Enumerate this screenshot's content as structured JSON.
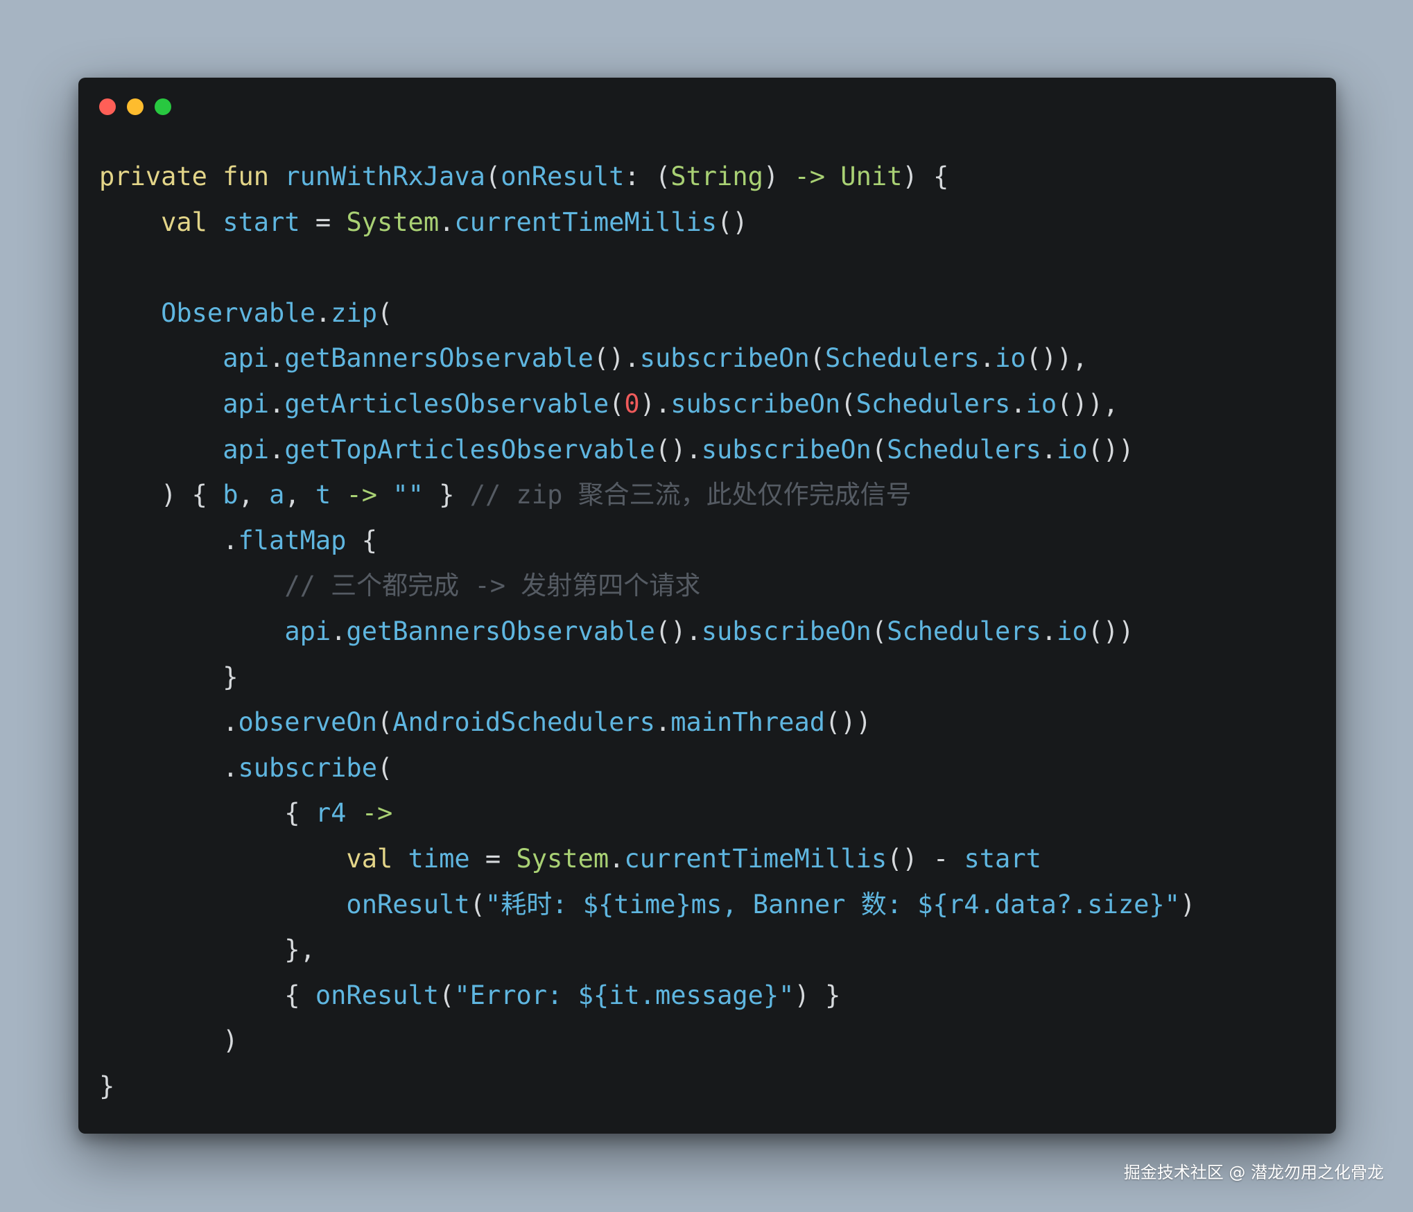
{
  "window": {
    "buttons": [
      {
        "name": "close",
        "color": "#ff5f57"
      },
      {
        "name": "minimize",
        "color": "#febc2e"
      },
      {
        "name": "maximize",
        "color": "#28c840"
      }
    ]
  },
  "code_lines": [
    [
      {
        "t": "private fun ",
        "k": "kw"
      },
      {
        "t": "runWithRxJava",
        "k": "fn"
      },
      {
        "t": "(",
        "k": "plain"
      },
      {
        "t": "onResult",
        "k": "fn"
      },
      {
        "t": ": (",
        "k": "plain"
      },
      {
        "t": "String",
        "k": "ty"
      },
      {
        "t": ") ",
        "k": "plain"
      },
      {
        "t": "->",
        "k": "ty"
      },
      {
        "t": " ",
        "k": "plain"
      },
      {
        "t": "Unit",
        "k": "ty"
      },
      {
        "t": ") {",
        "k": "plain"
      }
    ],
    [
      {
        "t": "    ",
        "k": "plain"
      },
      {
        "t": "val",
        "k": "kw"
      },
      {
        "t": " ",
        "k": "plain"
      },
      {
        "t": "start",
        "k": "fn"
      },
      {
        "t": " = ",
        "k": "plain"
      },
      {
        "t": "System",
        "k": "ty"
      },
      {
        "t": ".",
        "k": "plain"
      },
      {
        "t": "currentTimeMillis",
        "k": "fn"
      },
      {
        "t": "()",
        "k": "plain"
      }
    ],
    [],
    [
      {
        "t": "    ",
        "k": "plain"
      },
      {
        "t": "Observable",
        "k": "fn"
      },
      {
        "t": ".",
        "k": "plain"
      },
      {
        "t": "zip",
        "k": "fn"
      },
      {
        "t": "(",
        "k": "plain"
      }
    ],
    [
      {
        "t": "        ",
        "k": "plain"
      },
      {
        "t": "api",
        "k": "fn"
      },
      {
        "t": ".",
        "k": "plain"
      },
      {
        "t": "getBannersObservable",
        "k": "fn"
      },
      {
        "t": "().",
        "k": "plain"
      },
      {
        "t": "subscribeOn",
        "k": "fn"
      },
      {
        "t": "(",
        "k": "plain"
      },
      {
        "t": "Schedulers",
        "k": "fn"
      },
      {
        "t": ".",
        "k": "plain"
      },
      {
        "t": "io",
        "k": "fn"
      },
      {
        "t": "()),",
        "k": "plain"
      }
    ],
    [
      {
        "t": "        ",
        "k": "plain"
      },
      {
        "t": "api",
        "k": "fn"
      },
      {
        "t": ".",
        "k": "plain"
      },
      {
        "t": "getArticlesObservable",
        "k": "fn"
      },
      {
        "t": "(",
        "k": "plain"
      },
      {
        "t": "0",
        "k": "num"
      },
      {
        "t": ").",
        "k": "plain"
      },
      {
        "t": "subscribeOn",
        "k": "fn"
      },
      {
        "t": "(",
        "k": "plain"
      },
      {
        "t": "Schedulers",
        "k": "fn"
      },
      {
        "t": ".",
        "k": "plain"
      },
      {
        "t": "io",
        "k": "fn"
      },
      {
        "t": "()),",
        "k": "plain"
      }
    ],
    [
      {
        "t": "        ",
        "k": "plain"
      },
      {
        "t": "api",
        "k": "fn"
      },
      {
        "t": ".",
        "k": "plain"
      },
      {
        "t": "getTopArticlesObservable",
        "k": "fn"
      },
      {
        "t": "().",
        "k": "plain"
      },
      {
        "t": "subscribeOn",
        "k": "fn"
      },
      {
        "t": "(",
        "k": "plain"
      },
      {
        "t": "Schedulers",
        "k": "fn"
      },
      {
        "t": ".",
        "k": "plain"
      },
      {
        "t": "io",
        "k": "fn"
      },
      {
        "t": "())",
        "k": "plain"
      }
    ],
    [
      {
        "t": "    ) { ",
        "k": "plain"
      },
      {
        "t": "b",
        "k": "fn"
      },
      {
        "t": ", ",
        "k": "plain"
      },
      {
        "t": "a",
        "k": "fn"
      },
      {
        "t": ", ",
        "k": "plain"
      },
      {
        "t": "t",
        "k": "fn"
      },
      {
        "t": " ",
        "k": "plain"
      },
      {
        "t": "->",
        "k": "ty"
      },
      {
        "t": " ",
        "k": "plain"
      },
      {
        "t": "\"\"",
        "k": "str"
      },
      {
        "t": " } ",
        "k": "plain"
      },
      {
        "t": "// zip 聚合三流，此处仅作完成信号",
        "k": "cm"
      }
    ],
    [
      {
        "t": "        .",
        "k": "plain"
      },
      {
        "t": "flatMap",
        "k": "fn"
      },
      {
        "t": " {",
        "k": "plain"
      }
    ],
    [
      {
        "t": "            ",
        "k": "plain"
      },
      {
        "t": "// 三个都完成 -> 发射第四个请求",
        "k": "cm"
      }
    ],
    [
      {
        "t": "            ",
        "k": "plain"
      },
      {
        "t": "api",
        "k": "fn"
      },
      {
        "t": ".",
        "k": "plain"
      },
      {
        "t": "getBannersObservable",
        "k": "fn"
      },
      {
        "t": "().",
        "k": "plain"
      },
      {
        "t": "subscribeOn",
        "k": "fn"
      },
      {
        "t": "(",
        "k": "plain"
      },
      {
        "t": "Schedulers",
        "k": "fn"
      },
      {
        "t": ".",
        "k": "plain"
      },
      {
        "t": "io",
        "k": "fn"
      },
      {
        "t": "())",
        "k": "plain"
      }
    ],
    [
      {
        "t": "        }",
        "k": "plain"
      }
    ],
    [
      {
        "t": "        .",
        "k": "plain"
      },
      {
        "t": "observeOn",
        "k": "fn"
      },
      {
        "t": "(",
        "k": "plain"
      },
      {
        "t": "AndroidSchedulers",
        "k": "fn"
      },
      {
        "t": ".",
        "k": "plain"
      },
      {
        "t": "mainThread",
        "k": "fn"
      },
      {
        "t": "())",
        "k": "plain"
      }
    ],
    [
      {
        "t": "        .",
        "k": "plain"
      },
      {
        "t": "subscribe",
        "k": "fn"
      },
      {
        "t": "(",
        "k": "plain"
      }
    ],
    [
      {
        "t": "            { ",
        "k": "plain"
      },
      {
        "t": "r4",
        "k": "fn"
      },
      {
        "t": " ",
        "k": "plain"
      },
      {
        "t": "->",
        "k": "ty"
      }
    ],
    [
      {
        "t": "                ",
        "k": "plain"
      },
      {
        "t": "val",
        "k": "kw"
      },
      {
        "t": " ",
        "k": "plain"
      },
      {
        "t": "time",
        "k": "fn"
      },
      {
        "t": " = ",
        "k": "plain"
      },
      {
        "t": "System",
        "k": "ty"
      },
      {
        "t": ".",
        "k": "plain"
      },
      {
        "t": "currentTimeMillis",
        "k": "fn"
      },
      {
        "t": "() - ",
        "k": "plain"
      },
      {
        "t": "start",
        "k": "fn"
      }
    ],
    [
      {
        "t": "                ",
        "k": "plain"
      },
      {
        "t": "onResult",
        "k": "fn"
      },
      {
        "t": "(",
        "k": "plain"
      },
      {
        "t": "\"耗时: ${time}ms, Banner 数: ${r4.data?.size}\"",
        "k": "str"
      },
      {
        "t": ")",
        "k": "plain"
      }
    ],
    [
      {
        "t": "            },",
        "k": "plain"
      }
    ],
    [
      {
        "t": "            { ",
        "k": "plain"
      },
      {
        "t": "onResult",
        "k": "fn"
      },
      {
        "t": "(",
        "k": "plain"
      },
      {
        "t": "\"Error: ${it.message}\"",
        "k": "str"
      },
      {
        "t": ") }",
        "k": "plain"
      }
    ],
    [
      {
        "t": "        )",
        "k": "plain"
      }
    ],
    [
      {
        "t": "}",
        "k": "plain"
      }
    ]
  ],
  "watermark": "掘金技术社区 @ 潜龙勿用之化骨龙"
}
